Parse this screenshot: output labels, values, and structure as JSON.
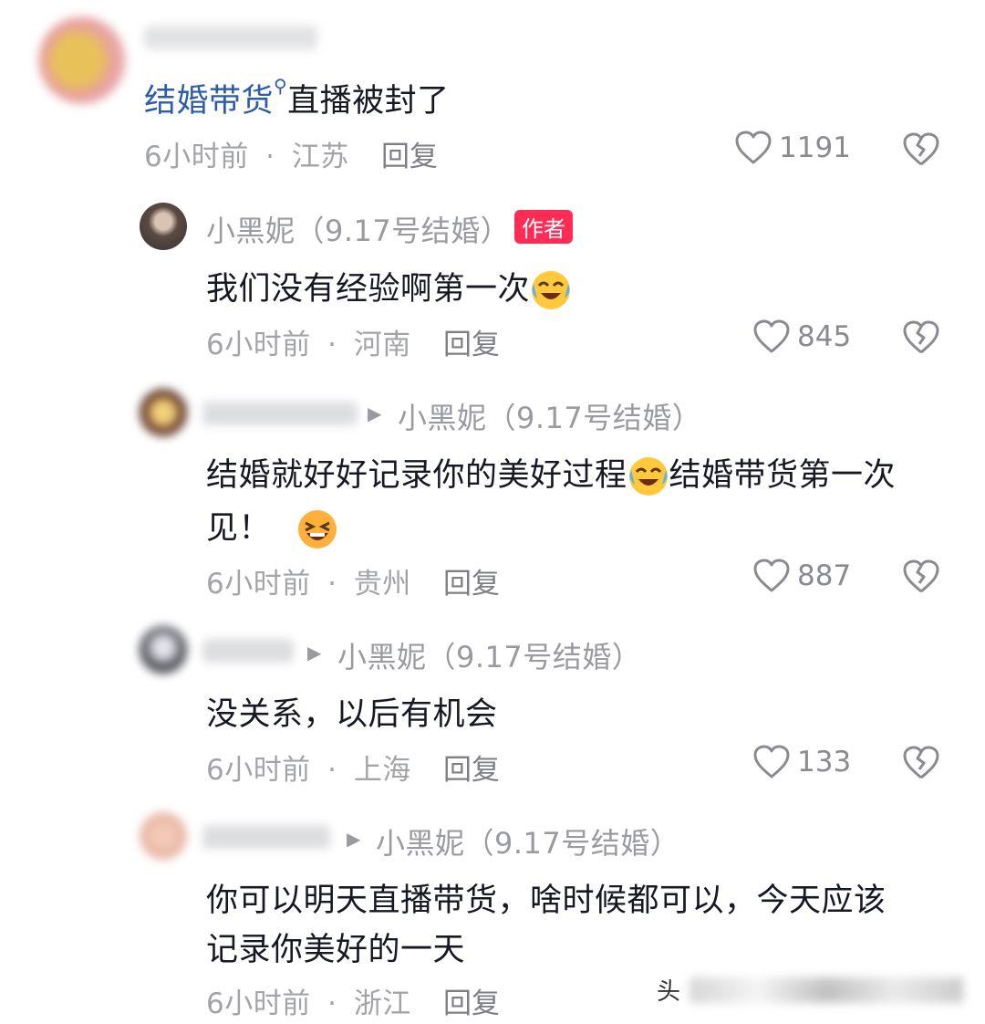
{
  "root_comment": {
    "topic": "结婚带货",
    "text": "直播被封了",
    "time": "6小时前",
    "location": "江苏",
    "reply_label": "回复",
    "likes": "1191"
  },
  "replies": [
    {
      "name": "小黑妮（9.17号结婚）",
      "badge": "作者",
      "text": "我们没有经验啊第一次",
      "time": "6小时前",
      "location": "河南",
      "reply_label": "回复",
      "likes": "845"
    },
    {
      "reply_to": "小黑妮（9.17号结婚）",
      "text_line1_a": "结婚就好好记录你的美好过程",
      "text_line1_b": "结婚带货第一次",
      "text_line2": "见！",
      "time": "6小时前",
      "location": "贵州",
      "reply_label": "回复",
      "likes": "887"
    },
    {
      "reply_to": "小黑妮（9.17号结婚）",
      "text": "没关系，以后有机会",
      "time": "6小时前",
      "location": "上海",
      "reply_label": "回复",
      "likes": "133"
    },
    {
      "reply_to": "小黑妮（9.17号结婚）",
      "text_line1": "你可以明天直播带货，啥时候都可以，今天应该",
      "text_line2": "记录你美好的一天",
      "time": "6小时前",
      "location": "浙江",
      "reply_label": "回复"
    }
  ],
  "separator": "·",
  "watermark": "头",
  "colors": {
    "author_badge": "#fe2c55",
    "topic_link": "#2d5ca8"
  }
}
